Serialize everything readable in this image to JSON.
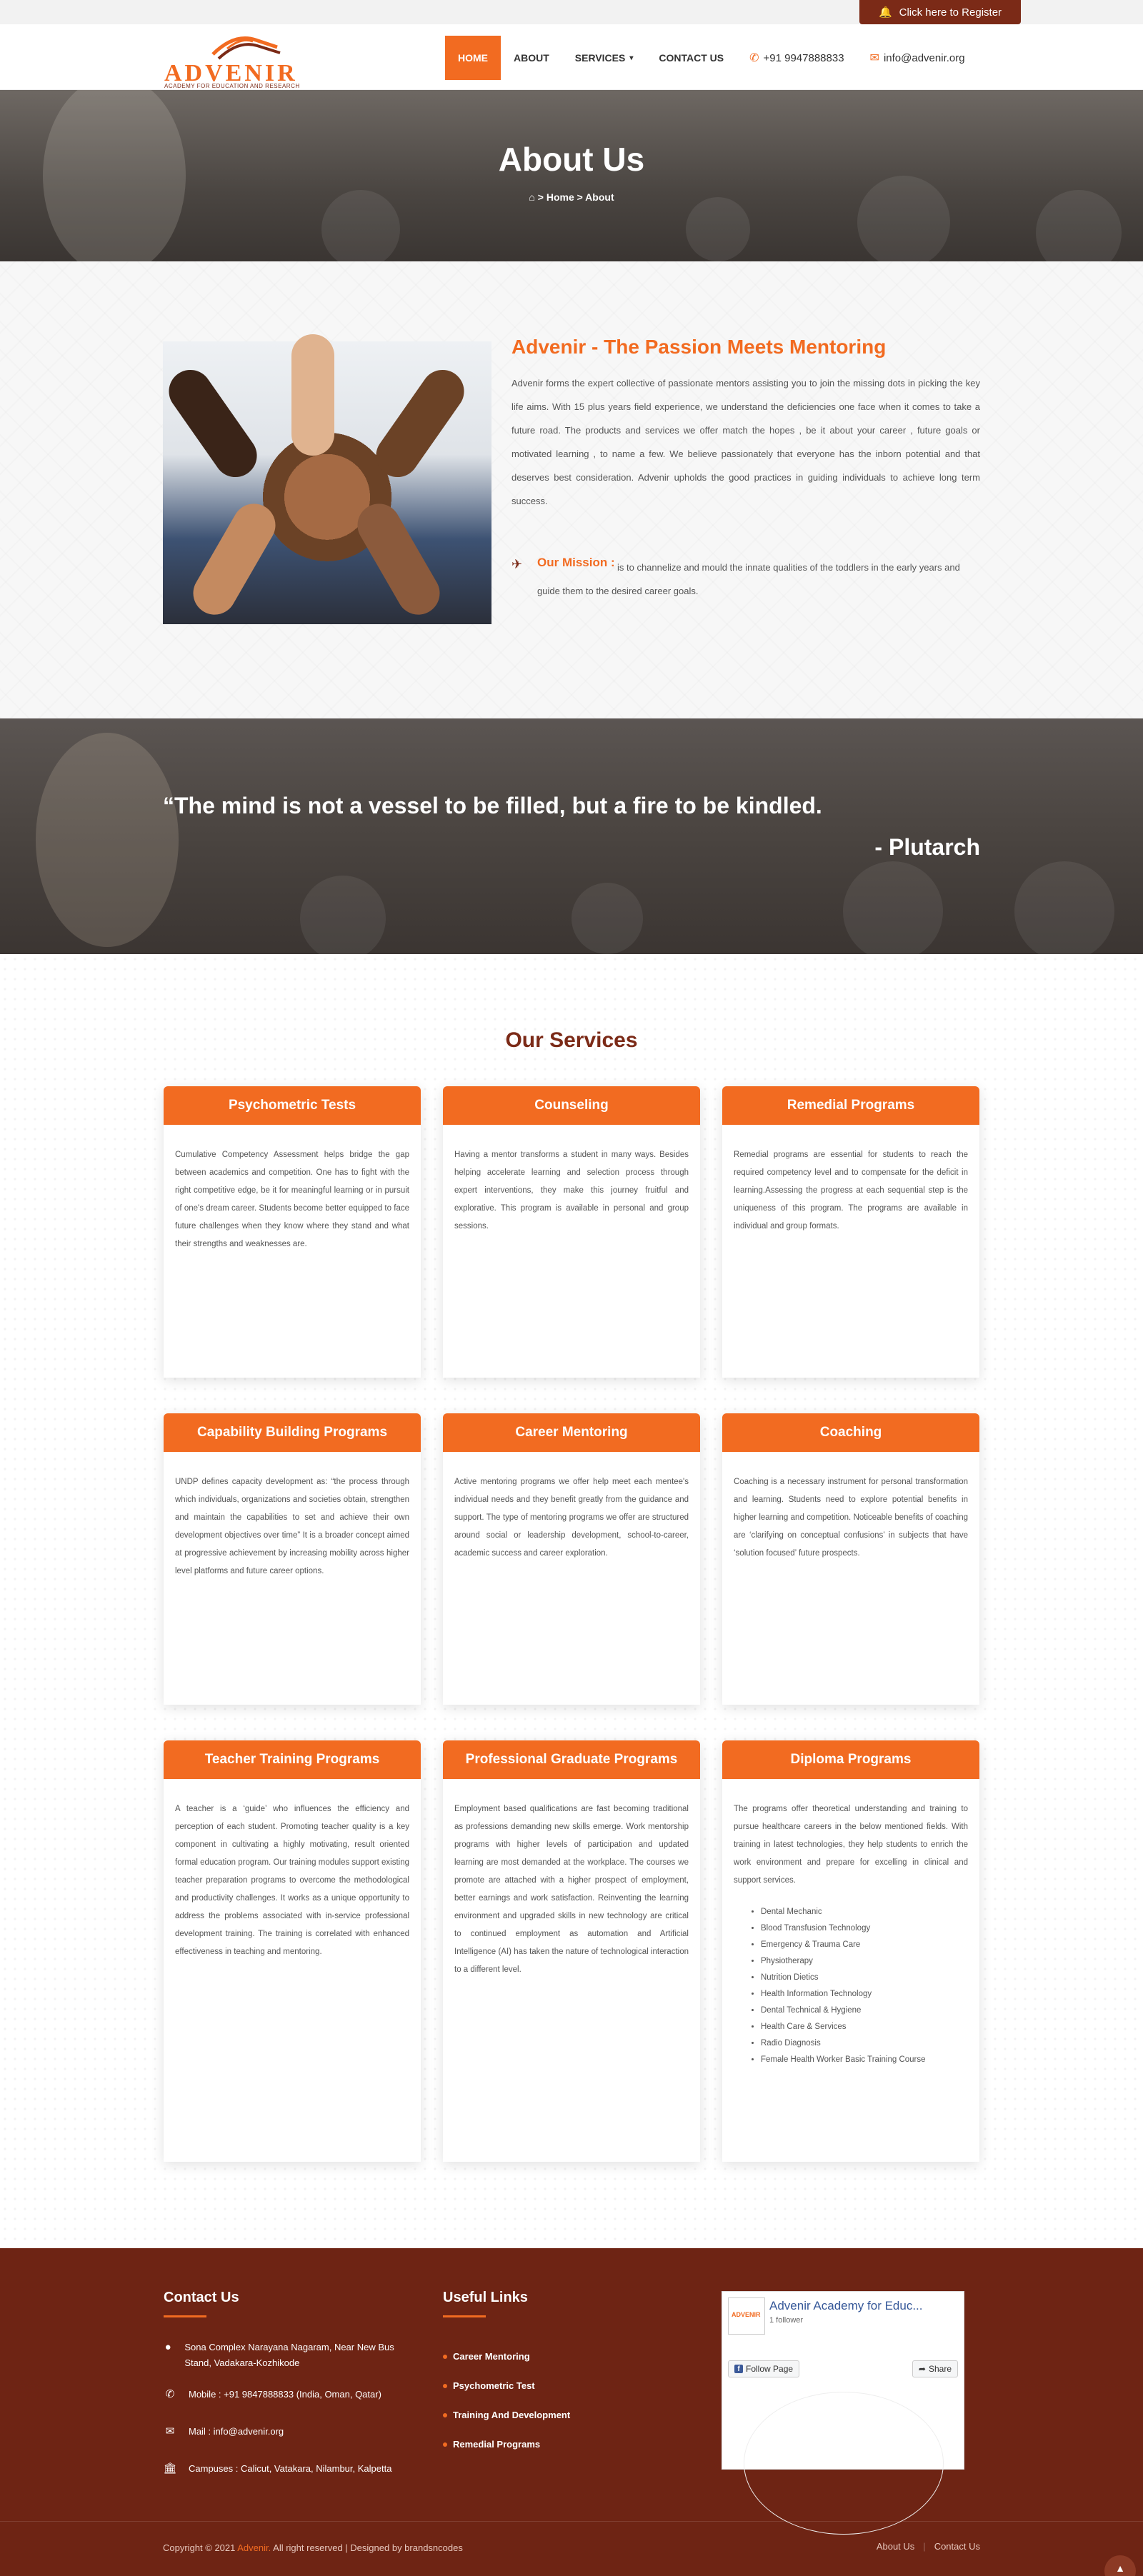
{
  "topbar": {
    "register_label": "Click here to Register",
    "bell_icon": "bell-icon"
  },
  "brand": {
    "name": "ADVENIR",
    "tagline": "ACADEMY FOR EDUCATION AND RESEARCH",
    "accent": "#f26b21",
    "dark": "#7b2a17"
  },
  "nav": {
    "items": [
      {
        "label": "HOME",
        "active": true
      },
      {
        "label": "ABOUT"
      },
      {
        "label": "SERVICES"
      },
      {
        "label": "CONTACT US"
      }
    ],
    "phone": "+91 9947888833",
    "email": "info@advenir.org"
  },
  "hero": {
    "title": "About Us",
    "crumb_home": "Home",
    "crumb_current": "About"
  },
  "about": {
    "title": "Advenir - The Passion Meets Mentoring",
    "text": "Advenir forms the expert collective of passionate mentors assisting you to join the missing dots in picking the key life aims. With 15 plus years field experience, we understand the deficiencies one face when it comes to take a future road. The products and services we offer match the hopes , be it about your career , future goals or motivated learning , to name a few. We believe passionately that everyone has the inborn potential and that deserves best consideration. Advenir upholds the good practices in guiding individuals to achieve long term success.",
    "mission_label": "Our Mission :",
    "mission_text": "is to channelize and mould the innate qualities of the toddlers in the early years and guide them to the desired career goals."
  },
  "quote": {
    "text": "“The mind is not a vessel to be filled, but a fire to be kindled.",
    "author": "- Plutarch"
  },
  "services": {
    "title": "Our Services",
    "cards": [
      {
        "title": "Psychometric Tests",
        "text": "Cumulative Competency Assessment helps bridge the gap between academics and competition. One has to fight with the right competitive edge, be it for meaningful learning or in pursuit of one's dream career. Students become better equipped to face future challenges when they know where they stand and what their strengths and weaknesses are."
      },
      {
        "title": "Counseling",
        "text": "Having a mentor transforms a student in many ways. Besides helping accelerate learning and selection process through expert interventions, they make this journey fruitful and explorative. This program is available in personal and group sessions."
      },
      {
        "title": "Remedial Programs",
        "text": "Remedial programs are essential for students to reach the required competency level and to compensate for the deficit in learning.Assessing the progress at each sequential step is the uniqueness of this program. The programs are available in individual and group formats."
      },
      {
        "title": "Capability Building Programs",
        "text": "UNDP defines capacity development as: “the process through which individuals, organizations and societies obtain, strengthen and maintain the capabilities to set and achieve their own development objectives over time” It is a broader concept aimed at progressive achievement by increasing mobility across higher level platforms and future career options."
      },
      {
        "title": "Career Mentoring",
        "text": "Active mentoring programs we offer help meet each mentee's individual needs and they benefit greatly from the guidance and support. The type of mentoring programs we offer are structured around social or leadership development, school-to-career, academic success and career exploration."
      },
      {
        "title": "Coaching",
        "text": "Coaching is a necessary instrument for personal transformation and learning. Students need to explore potential benefits in higher learning and competition. Noticeable benefits of coaching are ‘clarifying on conceptual confusions’ in subjects that have ‘solution focused’ future prospects."
      },
      {
        "title": "Teacher Training Programs",
        "text": "A teacher is a ‘guide’ who influences the efficiency and perception of each student. Promoting teacher quality is a key component in cultivating a highly motivating, result oriented formal education program. Our training modules support existing teacher preparation programs to overcome the methodological and productivity challenges. It works as a unique opportunity to address the problems associated with in-service professional development training. The training is correlated with enhanced effectiveness in teaching and mentoring."
      },
      {
        "title": "Professional Graduate Programs",
        "text": "Employment based qualifications are fast becoming traditional as professions demanding new skills emerge. Work mentorship programs with higher levels of participation and updated learning are most demanded at the workplace. The courses we promote are attached with a higher prospect of employment, better earnings and work satisfaction. Reinventing the learning environment and upgraded skills in new technology are critical to continued employment as automation and Artificial Intelligence (AI) has taken the nature of technological interaction to a different level."
      },
      {
        "title": "Diploma Programs",
        "text": "The programs offer theoretical understanding and training to pursue healthcare careers in the below mentioned fields. With training in latest technologies, they help students to enrich the work environment and prepare for excelling in clinical and support services.",
        "list": [
          "Dental Mechanic",
          "Blood Transfusion Technology",
          "Emergency & Trauma Care",
          "Physiotherapy",
          "Nutrition Dietics",
          "Health Information Technology",
          "Dental Technical & Hygiene",
          "Health Care & Services",
          "Radio Diagnosis",
          "Female Health Worker Basic Training Course"
        ]
      }
    ]
  },
  "footer": {
    "contact_title": "Contact Us",
    "address": "Sona Complex Narayana Nagaram, Near New Bus Stand, Vadakara-Kozhikode",
    "mobile": "Mobile : +91 9847888833 (India, Oman, Qatar)",
    "mail": "Mail : info@advenir.org",
    "campuses": "Campuses : Calicut, Vatakara, Nilambur, Kalpetta",
    "links_title": "Useful Links",
    "links": [
      "Career Mentoring",
      "Psychometric Test",
      "Training And Development",
      "Remedial Programs"
    ],
    "fb": {
      "name": "Advenir Academy for Educ...",
      "followers": "1 follower",
      "follow_label": "Follow Page",
      "share_label": "Share",
      "logo_text": "ADVENIR"
    },
    "copyright_prefix": "Copyright © 2021",
    "copyright_brand": "Advenir.",
    "copyright_suffix": "All right reserved | Designed by brandsncodes",
    "bottom_links": [
      "About Us",
      "Contact Us"
    ]
  }
}
